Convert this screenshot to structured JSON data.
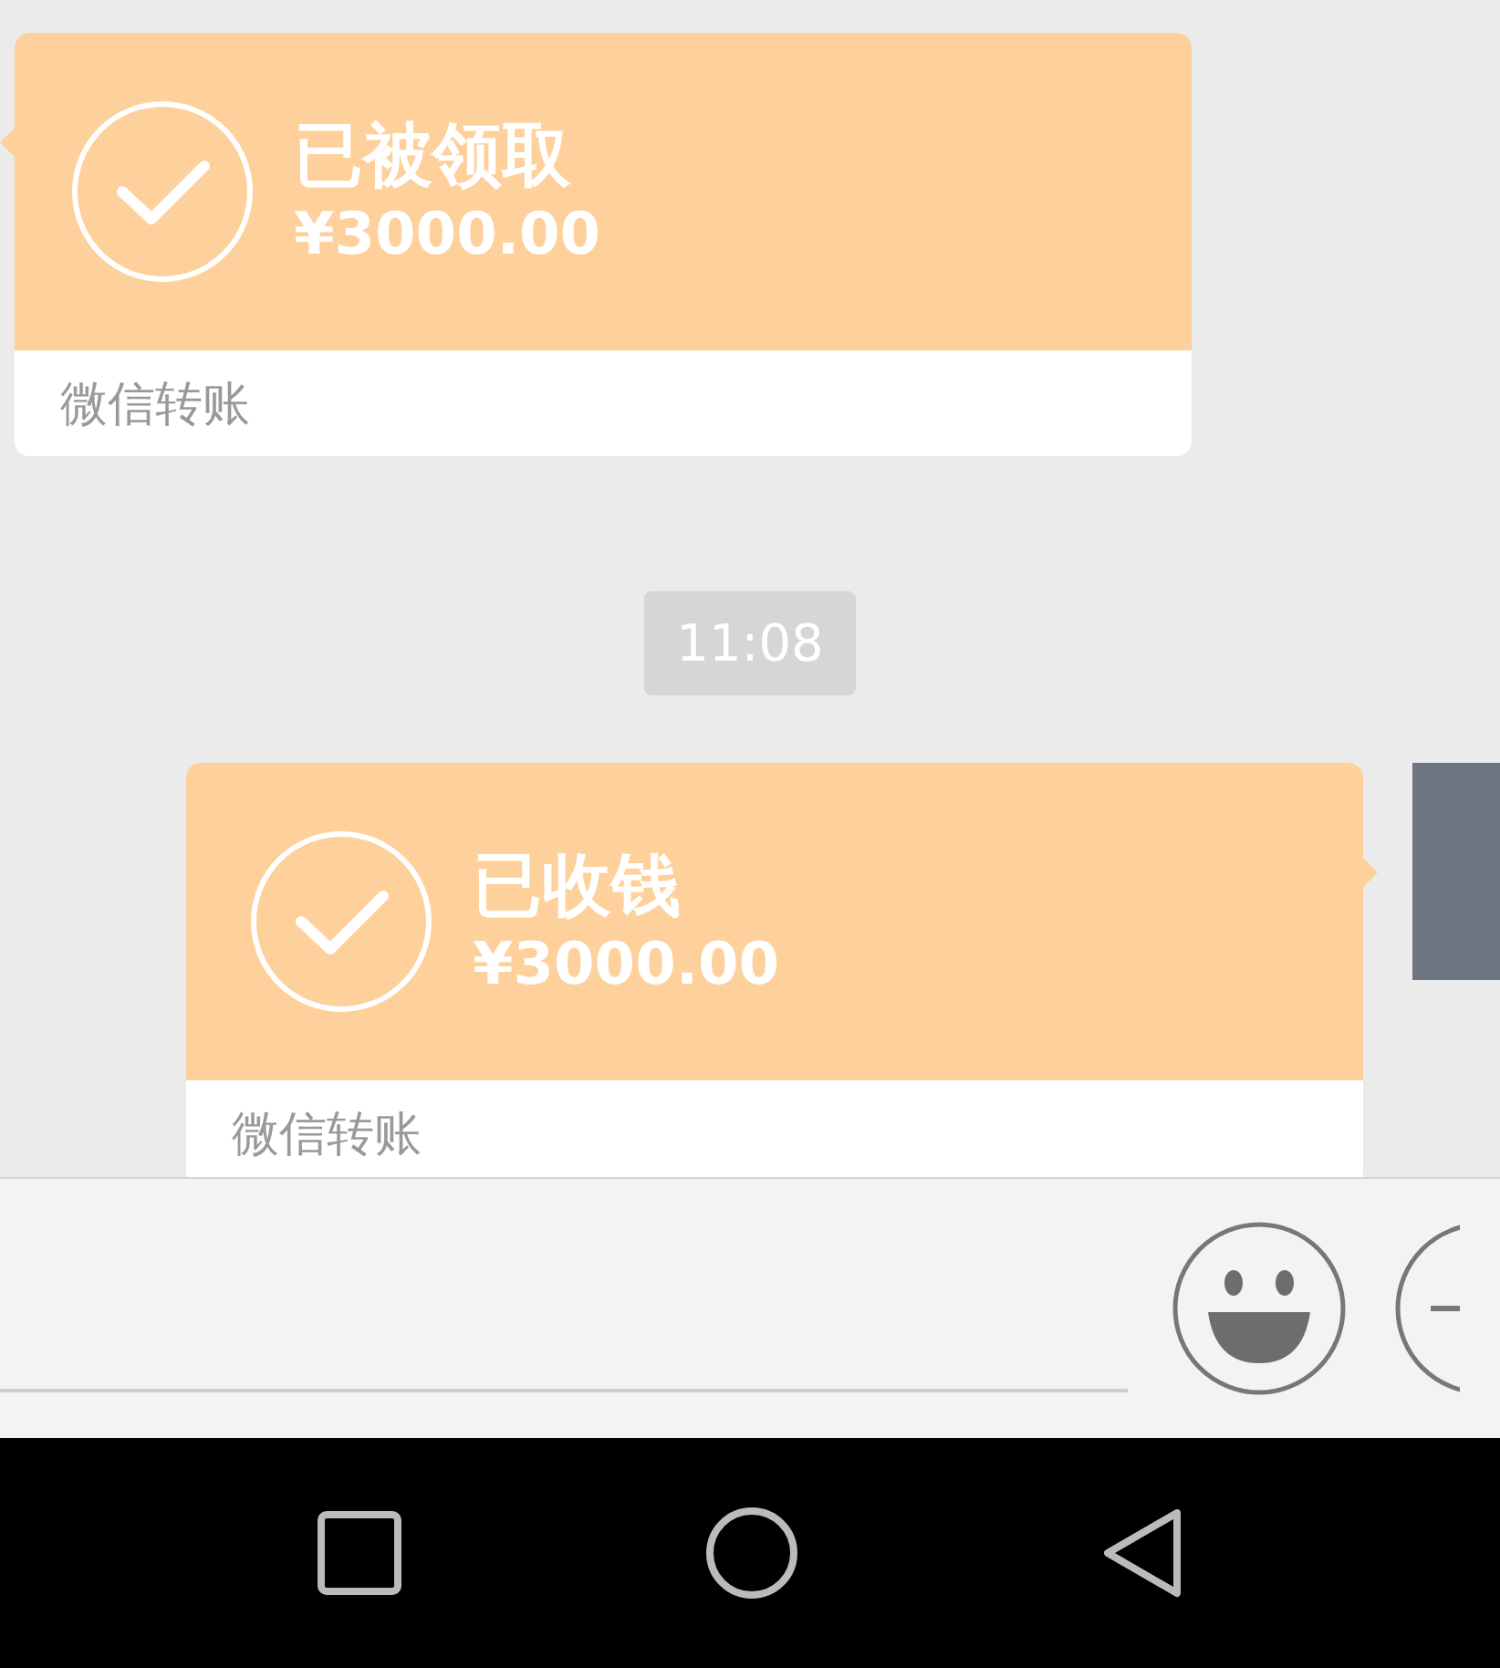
{
  "messages": [
    {
      "kind": "transfer",
      "outgoing": false,
      "status": "已被领取",
      "amount": "¥3000.00",
      "footer": "微信转账"
    },
    {
      "kind": "time",
      "text": "11:08"
    },
    {
      "kind": "transfer",
      "outgoing": true,
      "status": "已收钱",
      "amount": "¥3000.00",
      "footer": "微信转账"
    }
  ]
}
